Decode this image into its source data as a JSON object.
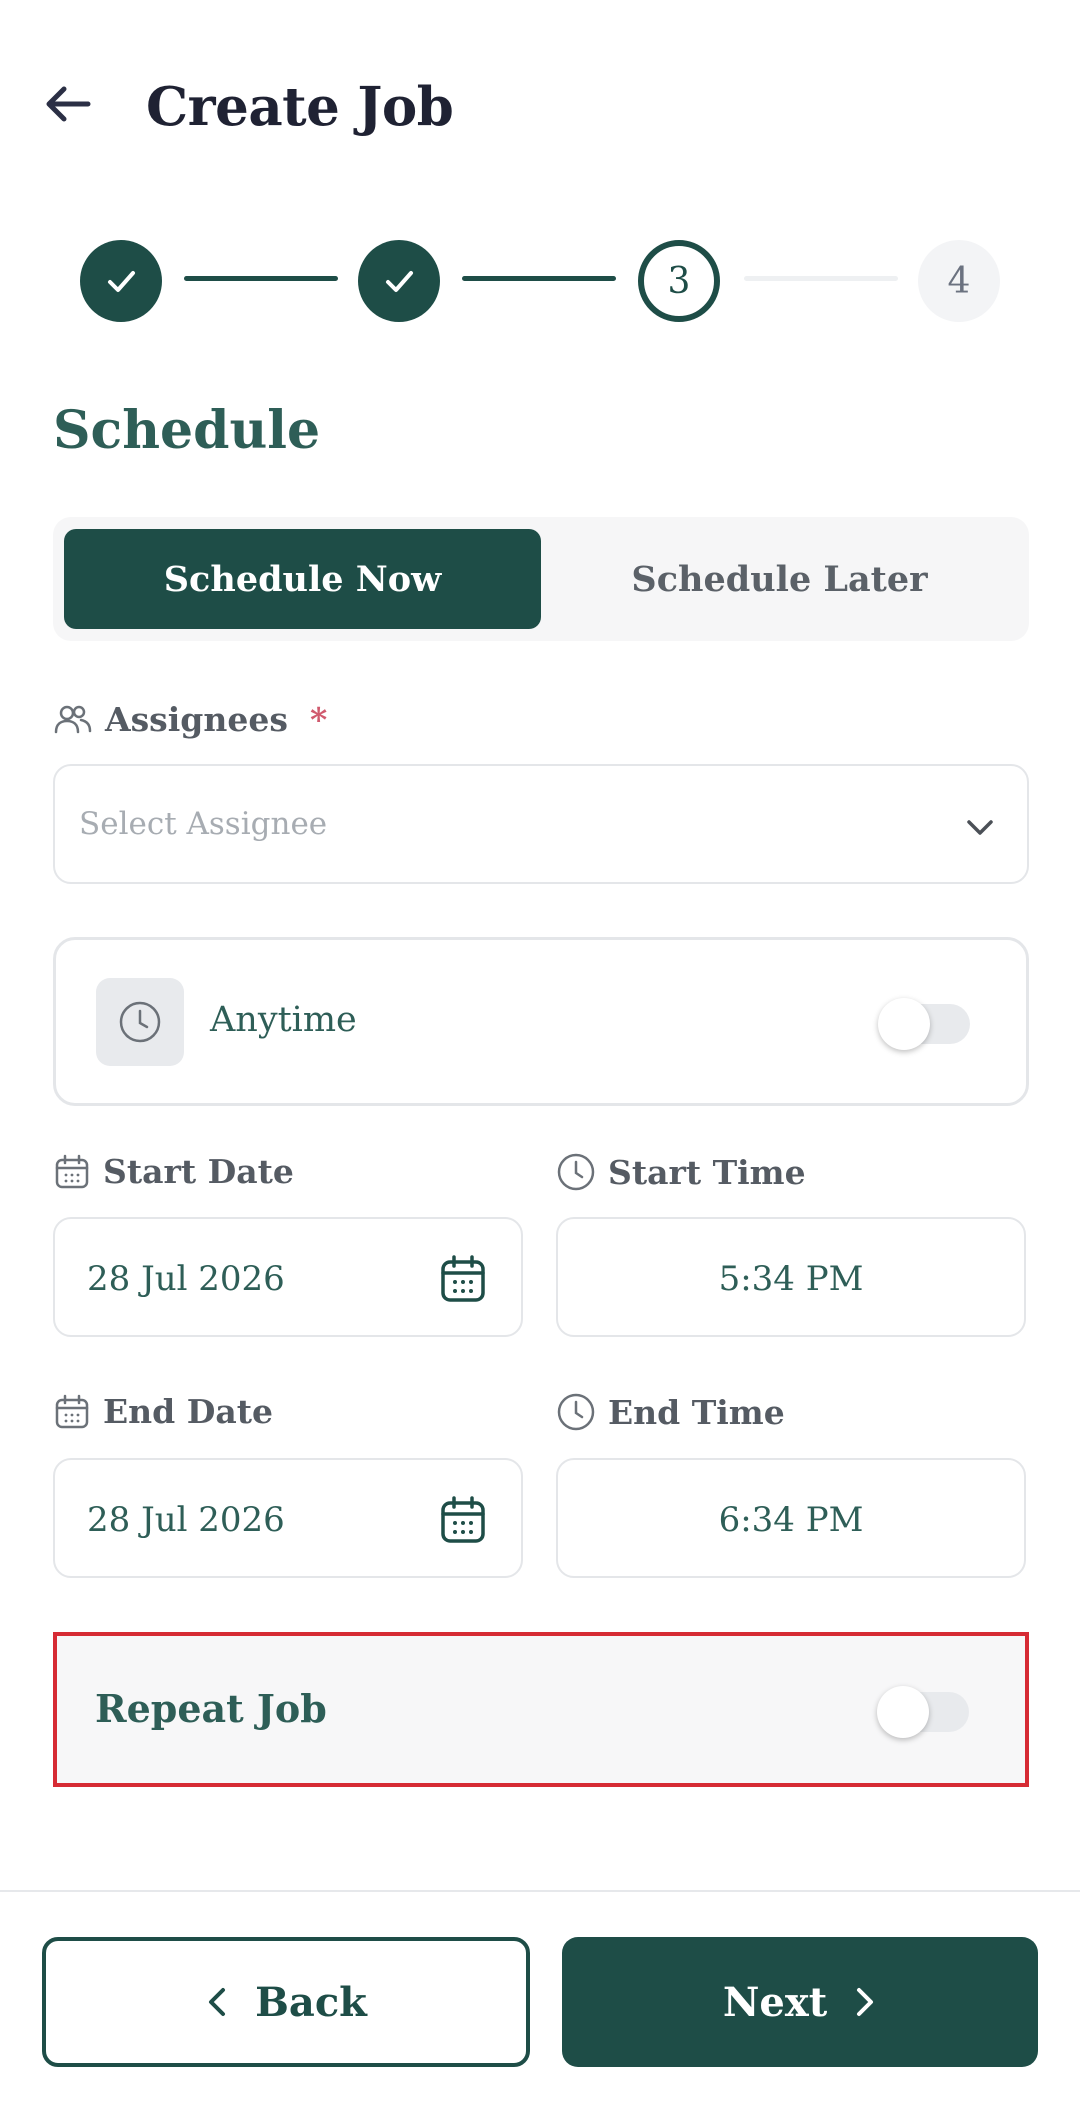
{
  "header": {
    "title": "Create Job"
  },
  "stepper": {
    "steps": [
      {
        "label": "1",
        "state": "done"
      },
      {
        "label": "2",
        "state": "done"
      },
      {
        "label": "3",
        "state": "current"
      },
      {
        "label": "4",
        "state": "future"
      }
    ]
  },
  "section": {
    "title": "Schedule"
  },
  "schedule_toggle": {
    "active": "Schedule Now",
    "inactive": "Schedule Later"
  },
  "assignees": {
    "label": "Assignees",
    "required_mark": "*",
    "placeholder": "Select Assignee"
  },
  "anytime": {
    "label": "Anytime",
    "enabled": false
  },
  "start_date": {
    "label": "Start Date",
    "value": "28 Jul 2026"
  },
  "start_time": {
    "label": "Start Time",
    "value": "5:34 PM"
  },
  "end_date": {
    "label": "End Date",
    "value": "28 Jul 2026"
  },
  "end_time": {
    "label": "End Time",
    "value": "6:34 PM"
  },
  "repeat_job": {
    "label": "Repeat Job",
    "enabled": false
  },
  "footer": {
    "back_label": "Back",
    "next_label": "Next"
  },
  "colors": {
    "primary": "#1e4d47",
    "highlight_border": "#d62b34",
    "required": "#d05a6e"
  }
}
